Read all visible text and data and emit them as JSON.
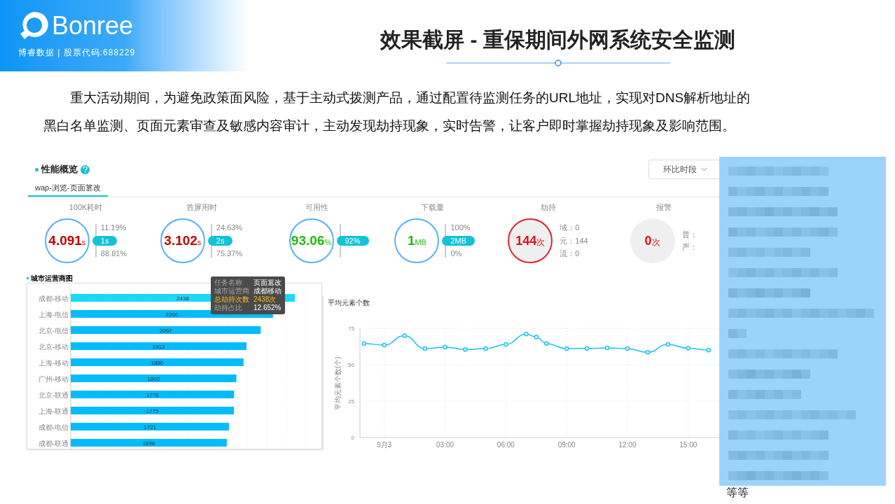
{
  "logo": {
    "name": "Bonree",
    "subtitle": "博睿数据 | 股票代码:688229"
  },
  "title": "效果截屏 - 重保期间外网系统安全监测",
  "description": "重大活动期间，为避免政策面风险，基于主动式拨测产品，通过配置待监测任务的URL地址，实现对DNS解析地址的黑白名单监测、页面元素审查及敏感内容审计，主动发现劫持现象，实时告警，让客户即时掌握劫持现象及影响范围。",
  "dashboard": {
    "section_title": "性能概览",
    "period_dropdown": "环比时段",
    "tabs": [
      {
        "label": "wap-浏览-页面篡改",
        "selected": true
      }
    ],
    "metrics": [
      {
        "kind": "ring",
        "label": "100K耗时",
        "value": "4.091",
        "unit": "s",
        "color": "#c00000",
        "compare": "1s",
        "upper": "11.19%",
        "lower": "88.81%"
      },
      {
        "kind": "ring",
        "label": "首屏用时",
        "value": "3.102",
        "unit": "s",
        "color": "#c00000",
        "compare": "2s",
        "upper": "24.63%",
        "lower": "75.37%"
      },
      {
        "kind": "ring",
        "label": "可用性",
        "value": "93.06",
        "unit": "%",
        "color": "#22b80e",
        "compare": "92%"
      },
      {
        "kind": "ring",
        "label": "下载量",
        "value": "1",
        "unit": "MB",
        "color": "#22b80e",
        "compare": "2MB",
        "upper": "100%",
        "lower": "0%"
      },
      {
        "kind": "hijack",
        "label": "劫持",
        "value": "144",
        "unit": "次",
        "lines": [
          "域：0",
          "元：144",
          "流：0"
        ]
      },
      {
        "kind": "alarm",
        "label": "报警",
        "value": "0",
        "unit": "次",
        "lines": [
          "普：",
          "严："
        ]
      }
    ],
    "bar_panel": {
      "title": "城市运营商图",
      "tooltip": [
        {
          "key": "任务名称",
          "value": "页面篡改",
          "highlight": false
        },
        {
          "key": "城市运营商",
          "value": "成都移动",
          "highlight": false
        },
        {
          "key": "总劫持次数",
          "value": "2438次",
          "highlight": true
        },
        {
          "key": "劫持占比",
          "value": "12.652%",
          "highlight": false
        }
      ],
      "chart_data": {
        "type": "bar",
        "orientation": "horizontal",
        "categories": [
          "成都-移动",
          "上海-电信",
          "北京-电信",
          "北京-移动",
          "上海-移动",
          "广州-移动",
          "北京-联通",
          "上海-联通",
          "成都-电信",
          "成都-联通"
        ],
        "values": [
          2438,
          2200,
          2067,
          1912,
          1880,
          1802,
          1776,
          1775,
          1721,
          1698
        ],
        "data_labels": true
      }
    },
    "line_panel": {
      "title": "平均元素个数",
      "chart_data": {
        "type": "line",
        "ylabel": "平均元素个数(个)",
        "ylim": [
          0,
          75
        ],
        "xlim": [
          -1.2,
          16.7
        ],
        "grid": true,
        "yticks": [
          0,
          25,
          50,
          75
        ],
        "xticks": [
          {
            "value": 0,
            "label": "9月3"
          },
          {
            "value": 3,
            "label": "03:00"
          },
          {
            "value": 6,
            "label": "06:00"
          },
          {
            "value": 9,
            "label": "09:00"
          },
          {
            "value": 12,
            "label": "12:00"
          },
          {
            "value": 15,
            "label": "15:00"
          }
        ],
        "x": [
          -1,
          0,
          1,
          2,
          3,
          4,
          5,
          6,
          7,
          7.5,
          8,
          9,
          10,
          11,
          12,
          13,
          14,
          15,
          16
        ],
        "series": [
          {
            "color": "#1ec0f5",
            "marker": true,
            "values": [
              64.5,
              63.5,
              70,
              61,
              62,
              60.5,
              61,
              64,
              71,
              69,
              64.5,
              61,
              61.2,
              61.5,
              61,
              58.5,
              64,
              61.3,
              60
            ]
          }
        ]
      }
    }
  },
  "redacted_note": "等等"
}
